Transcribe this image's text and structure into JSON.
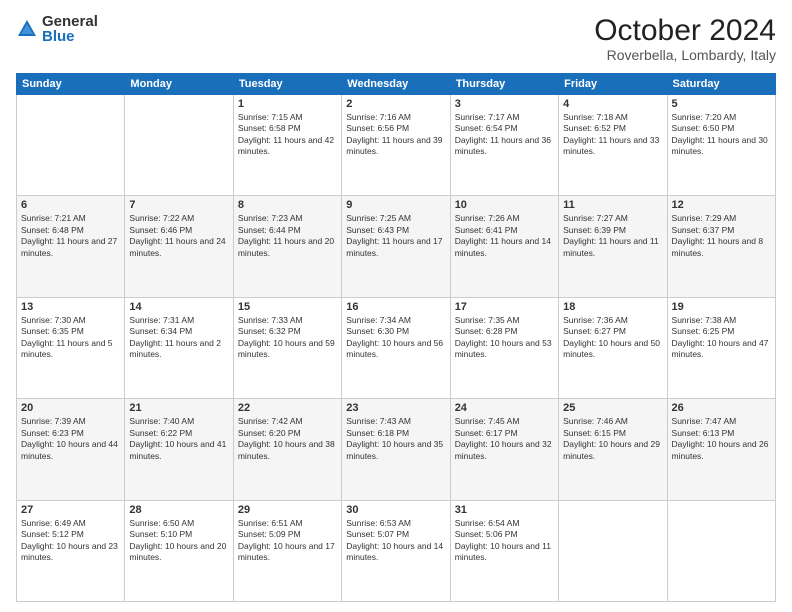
{
  "header": {
    "logo": {
      "general": "General",
      "blue": "Blue"
    },
    "title": "October 2024",
    "location": "Roverbella, Lombardy, Italy"
  },
  "weekdays": [
    "Sunday",
    "Monday",
    "Tuesday",
    "Wednesday",
    "Thursday",
    "Friday",
    "Saturday"
  ],
  "weeks": [
    [
      null,
      null,
      {
        "day": 1,
        "sunrise": "7:15 AM",
        "sunset": "6:58 PM",
        "daylight": "11 hours and 42 minutes."
      },
      {
        "day": 2,
        "sunrise": "7:16 AM",
        "sunset": "6:56 PM",
        "daylight": "11 hours and 39 minutes."
      },
      {
        "day": 3,
        "sunrise": "7:17 AM",
        "sunset": "6:54 PM",
        "daylight": "11 hours and 36 minutes."
      },
      {
        "day": 4,
        "sunrise": "7:18 AM",
        "sunset": "6:52 PM",
        "daylight": "11 hours and 33 minutes."
      },
      {
        "day": 5,
        "sunrise": "7:20 AM",
        "sunset": "6:50 PM",
        "daylight": "11 hours and 30 minutes."
      }
    ],
    [
      {
        "day": 6,
        "sunrise": "7:21 AM",
        "sunset": "6:48 PM",
        "daylight": "11 hours and 27 minutes."
      },
      {
        "day": 7,
        "sunrise": "7:22 AM",
        "sunset": "6:46 PM",
        "daylight": "11 hours and 24 minutes."
      },
      {
        "day": 8,
        "sunrise": "7:23 AM",
        "sunset": "6:44 PM",
        "daylight": "11 hours and 20 minutes."
      },
      {
        "day": 9,
        "sunrise": "7:25 AM",
        "sunset": "6:43 PM",
        "daylight": "11 hours and 17 minutes."
      },
      {
        "day": 10,
        "sunrise": "7:26 AM",
        "sunset": "6:41 PM",
        "daylight": "11 hours and 14 minutes."
      },
      {
        "day": 11,
        "sunrise": "7:27 AM",
        "sunset": "6:39 PM",
        "daylight": "11 hours and 11 minutes."
      },
      {
        "day": 12,
        "sunrise": "7:29 AM",
        "sunset": "6:37 PM",
        "daylight": "11 hours and 8 minutes."
      }
    ],
    [
      {
        "day": 13,
        "sunrise": "7:30 AM",
        "sunset": "6:35 PM",
        "daylight": "11 hours and 5 minutes."
      },
      {
        "day": 14,
        "sunrise": "7:31 AM",
        "sunset": "6:34 PM",
        "daylight": "11 hours and 2 minutes."
      },
      {
        "day": 15,
        "sunrise": "7:33 AM",
        "sunset": "6:32 PM",
        "daylight": "10 hours and 59 minutes."
      },
      {
        "day": 16,
        "sunrise": "7:34 AM",
        "sunset": "6:30 PM",
        "daylight": "10 hours and 56 minutes."
      },
      {
        "day": 17,
        "sunrise": "7:35 AM",
        "sunset": "6:28 PM",
        "daylight": "10 hours and 53 minutes."
      },
      {
        "day": 18,
        "sunrise": "7:36 AM",
        "sunset": "6:27 PM",
        "daylight": "10 hours and 50 minutes."
      },
      {
        "day": 19,
        "sunrise": "7:38 AM",
        "sunset": "6:25 PM",
        "daylight": "10 hours and 47 minutes."
      }
    ],
    [
      {
        "day": 20,
        "sunrise": "7:39 AM",
        "sunset": "6:23 PM",
        "daylight": "10 hours and 44 minutes."
      },
      {
        "day": 21,
        "sunrise": "7:40 AM",
        "sunset": "6:22 PM",
        "daylight": "10 hours and 41 minutes."
      },
      {
        "day": 22,
        "sunrise": "7:42 AM",
        "sunset": "6:20 PM",
        "daylight": "10 hours and 38 minutes."
      },
      {
        "day": 23,
        "sunrise": "7:43 AM",
        "sunset": "6:18 PM",
        "daylight": "10 hours and 35 minutes."
      },
      {
        "day": 24,
        "sunrise": "7:45 AM",
        "sunset": "6:17 PM",
        "daylight": "10 hours and 32 minutes."
      },
      {
        "day": 25,
        "sunrise": "7:46 AM",
        "sunset": "6:15 PM",
        "daylight": "10 hours and 29 minutes."
      },
      {
        "day": 26,
        "sunrise": "7:47 AM",
        "sunset": "6:13 PM",
        "daylight": "10 hours and 26 minutes."
      }
    ],
    [
      {
        "day": 27,
        "sunrise": "6:49 AM",
        "sunset": "5:12 PM",
        "daylight": "10 hours and 23 minutes."
      },
      {
        "day": 28,
        "sunrise": "6:50 AM",
        "sunset": "5:10 PM",
        "daylight": "10 hours and 20 minutes."
      },
      {
        "day": 29,
        "sunrise": "6:51 AM",
        "sunset": "5:09 PM",
        "daylight": "10 hours and 17 minutes."
      },
      {
        "day": 30,
        "sunrise": "6:53 AM",
        "sunset": "5:07 PM",
        "daylight": "10 hours and 14 minutes."
      },
      {
        "day": 31,
        "sunrise": "6:54 AM",
        "sunset": "5:06 PM",
        "daylight": "10 hours and 11 minutes."
      },
      null,
      null
    ]
  ],
  "labels": {
    "sunrise": "Sunrise:",
    "sunset": "Sunset:",
    "daylight": "Daylight:"
  }
}
